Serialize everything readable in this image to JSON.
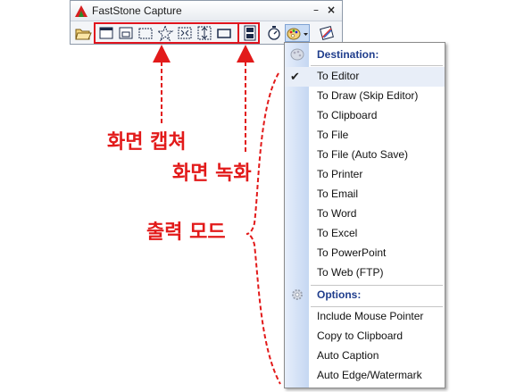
{
  "window": {
    "title": "FastStone Capture",
    "minimize_glyph": "–",
    "close_glyph": "×"
  },
  "toolbar": {
    "tools": [
      {
        "name": "open-file-icon"
      },
      {
        "name": "capture-active-window-icon"
      },
      {
        "name": "capture-window-object-icon"
      },
      {
        "name": "capture-rectangular-region-icon"
      },
      {
        "name": "capture-freehand-region-icon"
      },
      {
        "name": "capture-full-screen-icon"
      },
      {
        "name": "capture-scrolling-window-icon"
      },
      {
        "name": "capture-fixed-size-region-icon"
      },
      {
        "name": "screen-recorder-icon"
      },
      {
        "name": "delay-timer-icon"
      },
      {
        "name": "output-palette-icon"
      },
      {
        "name": "settings-icon"
      }
    ]
  },
  "menu": {
    "destination_header": "Destination:",
    "destinations": [
      {
        "label": "To Editor",
        "checked": true
      },
      {
        "label": "To Draw (Skip Editor)",
        "checked": false
      },
      {
        "label": "To Clipboard",
        "checked": false
      },
      {
        "label": "To File",
        "checked": false
      },
      {
        "label": "To File (Auto Save)",
        "checked": false
      },
      {
        "label": "To Printer",
        "checked": false
      },
      {
        "label": "To Email",
        "checked": false
      },
      {
        "label": "To Word",
        "checked": false
      },
      {
        "label": "To Excel",
        "checked": false
      },
      {
        "label": "To PowerPoint",
        "checked": false
      },
      {
        "label": "To Web (FTP)",
        "checked": false
      }
    ],
    "options_header": "Options:",
    "options": [
      {
        "label": "Include Mouse Pointer"
      },
      {
        "label": "Copy to Clipboard"
      },
      {
        "label": "Auto Caption"
      },
      {
        "label": "Auto Edge/Watermark"
      }
    ],
    "check_glyph": "✔"
  },
  "annotations": {
    "screen_capture": "화면 캡쳐",
    "screen_recording": "화면 녹화",
    "output_mode": "출력 모드"
  },
  "colors": {
    "annotation_red": "#e21a1a",
    "header_blue": "#1f3d8c",
    "menu_strip": "#c5d7f2"
  }
}
